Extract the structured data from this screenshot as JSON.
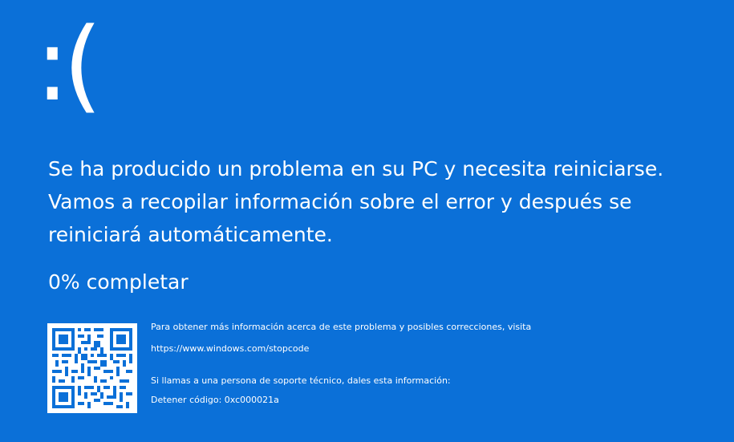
{
  "screen": {
    "background_color": "#0b70d8",
    "text_color": "#ffffff",
    "face": ":(",
    "message": "Se ha producido un problema en su PC y necesita reiniciarse. Vamos a recopilar información sobre el error y después se reiniciará automáticamente.",
    "progress_text": "0% completar",
    "progress_percent": 0,
    "qr_icon": "qr-code-icon",
    "info_line": "Para obtener más información acerca de este problema y posibles correcciones, visita",
    "stopcode_url": "https://www.windows.com/stopcode",
    "support_line": "Si llamas a una persona de soporte técnico, dales esta información:",
    "stop_code": "Detener código: 0xc000021a"
  }
}
